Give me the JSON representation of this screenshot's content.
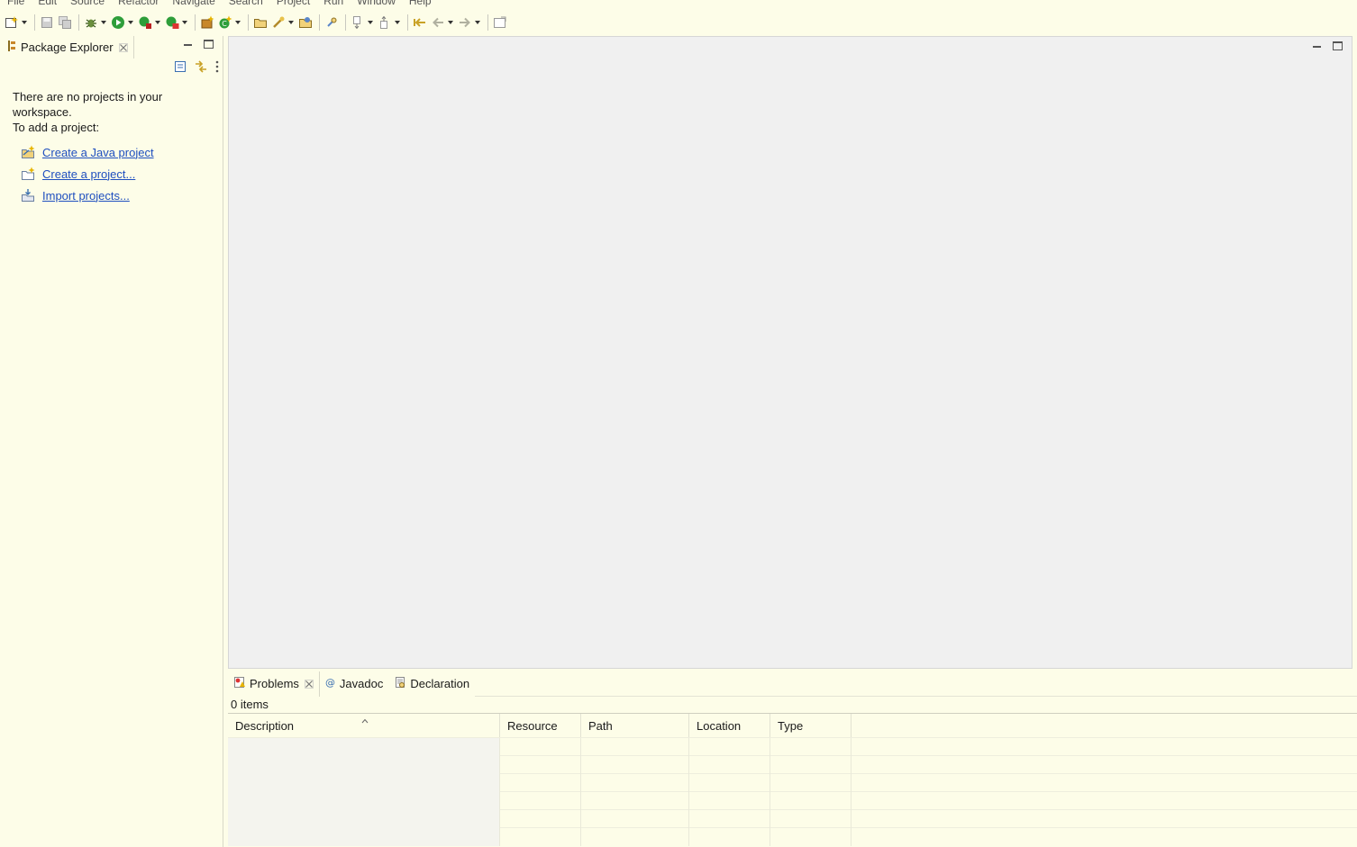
{
  "menu": [
    "File",
    "Edit",
    "Source",
    "Refactor",
    "Navigate",
    "Search",
    "Project",
    "Run",
    "Window",
    "Help"
  ],
  "toolbar": {
    "icons": [
      "new-wizard-icon",
      "save-icon",
      "save-all-icon",
      "debug-icon",
      "run-icon",
      "coverage-icon",
      "external-tools-icon",
      "new-java-package-icon",
      "new-java-class-icon",
      "open-type-icon",
      "search-icon",
      "open-task-icon",
      "toggle-mark-occurrences-icon",
      "next-annotation-icon",
      "previous-annotation-icon",
      "last-edit-location-icon",
      "back-icon",
      "forward-icon",
      "pin-editor-icon"
    ]
  },
  "package_explorer": {
    "title": "Package Explorer",
    "message_line1": "There are no projects in your",
    "message_line2": "workspace.",
    "message_line3": "To add a project:",
    "links": [
      {
        "label": "Create a Java project",
        "icon": "new-java-project-icon"
      },
      {
        "label": "Create a project...",
        "icon": "new-project-icon"
      },
      {
        "label": "Import projects...",
        "icon": "import-projects-icon"
      }
    ]
  },
  "bottom_panel": {
    "tabs": [
      {
        "label": "Problems",
        "icon": "problems-icon",
        "active": true
      },
      {
        "label": "Javadoc",
        "icon": "javadoc-icon",
        "active": false
      },
      {
        "label": "Declaration",
        "icon": "declaration-icon",
        "active": false
      }
    ],
    "items_count": "0 items",
    "columns": [
      "Description",
      "Resource",
      "Path",
      "Location",
      "Type"
    ]
  },
  "colors": {
    "background": "#fdfde8",
    "editor_background": "#f0f0f0",
    "link": "#1f4fbf"
  }
}
